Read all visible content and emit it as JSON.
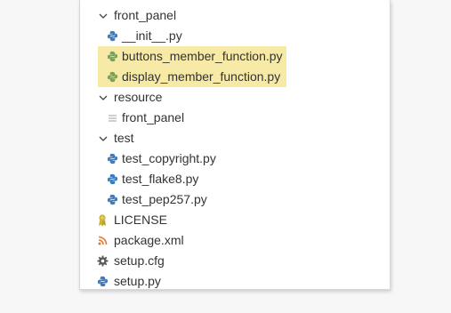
{
  "tree": {
    "front_panel_folder": "front_panel",
    "init_file": "__init__.py",
    "buttons_file": "buttons_member_function.py",
    "display_file": "display_member_function.py",
    "resource_folder": "resource",
    "resource_front_panel_file": "front_panel",
    "test_folder": "test",
    "test_copyright_file": "test_copyright.py",
    "test_flake8_file": "test_flake8.py",
    "test_pep257_file": "test_pep257.py",
    "license_file": "LICENSE",
    "package_file": "package.xml",
    "setup_cfg_file": "setup.cfg",
    "setup_py_file": "setup.py"
  },
  "colors": {
    "highlight": "#f7e9a6",
    "python_blue": "#3b7bbf",
    "python_green": "#7ba05b",
    "license_yellow": "#cbb534",
    "rss_orange": "#e8772e",
    "gear_gray": "#5a5a5a"
  }
}
